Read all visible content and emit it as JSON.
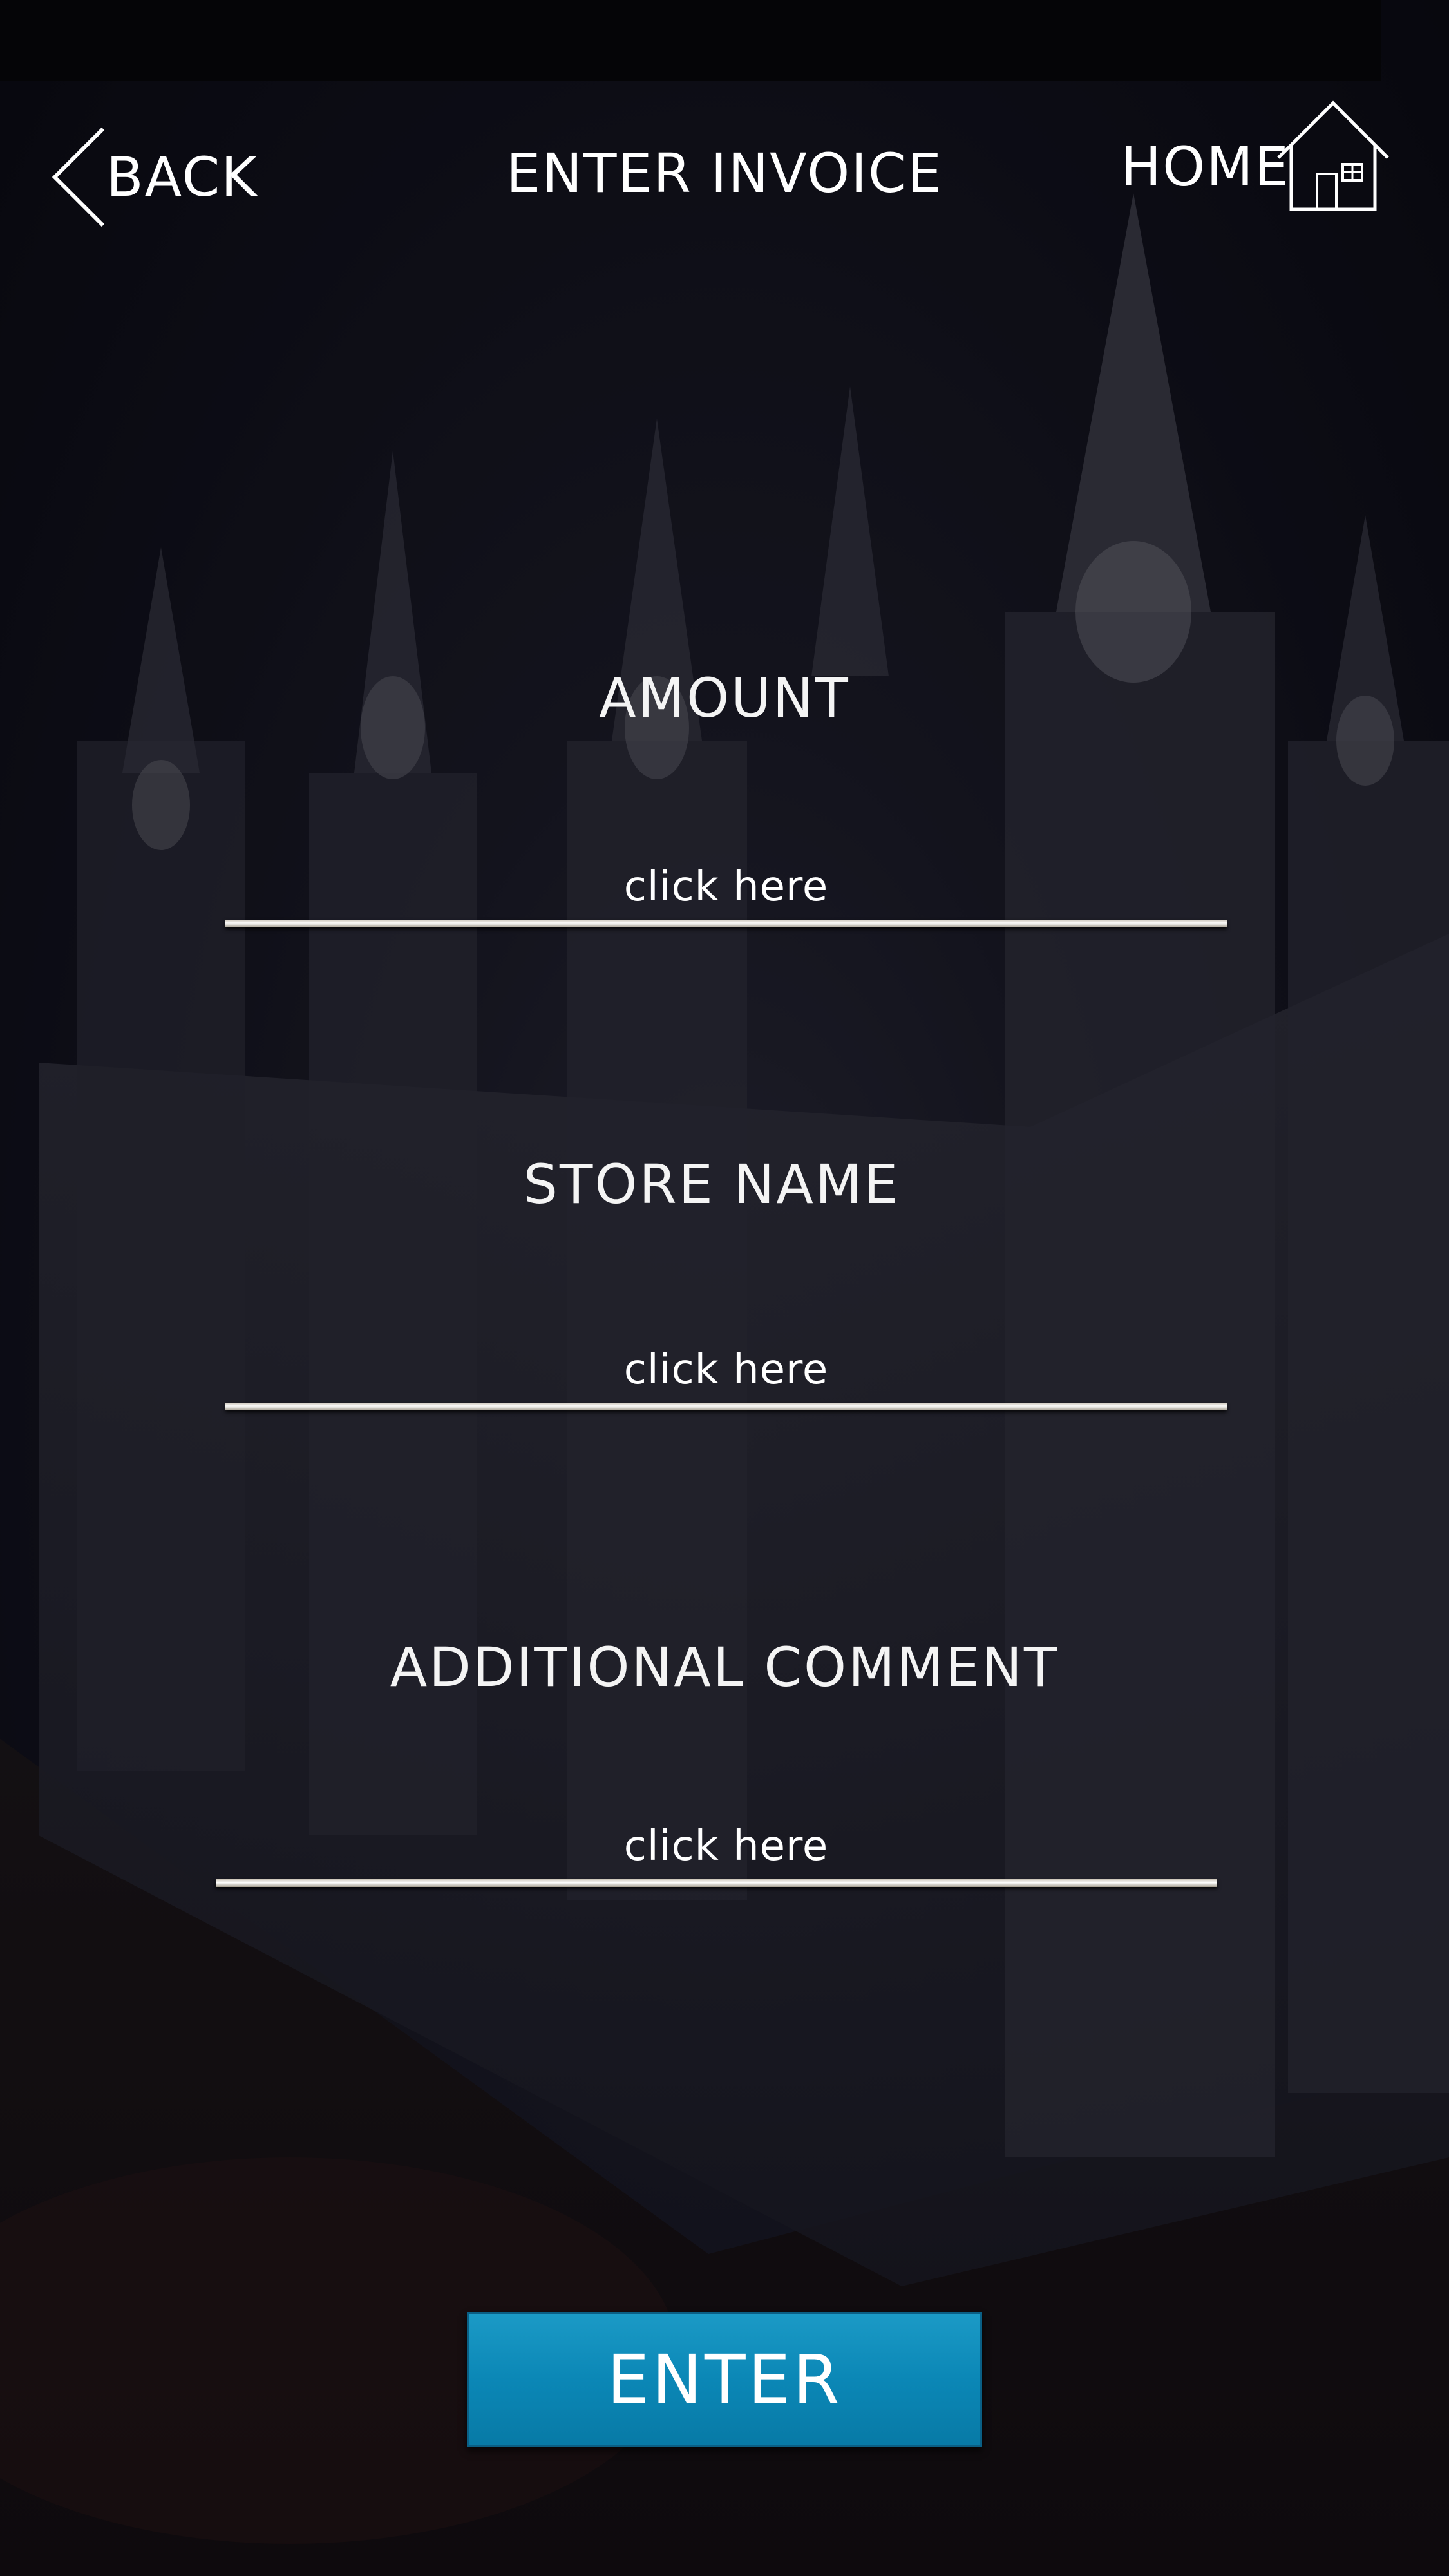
{
  "header": {
    "title": "ENTER INVOICE",
    "back_label": "BACK",
    "home_label": "HOME"
  },
  "form": {
    "fields": [
      {
        "label": "AMOUNT",
        "hint": "click here"
      },
      {
        "label": "STORE NAME",
        "hint": "click here"
      },
      {
        "label": "ADDITIONAL COMMENT",
        "hint": "click here"
      }
    ],
    "submit_label": "ENTER"
  },
  "icons": {
    "back": "chevron-left-icon",
    "home": "house-icon"
  },
  "colors": {
    "accent": "#0b87b6",
    "text": "#ffffff",
    "background": "#0f0f17"
  }
}
